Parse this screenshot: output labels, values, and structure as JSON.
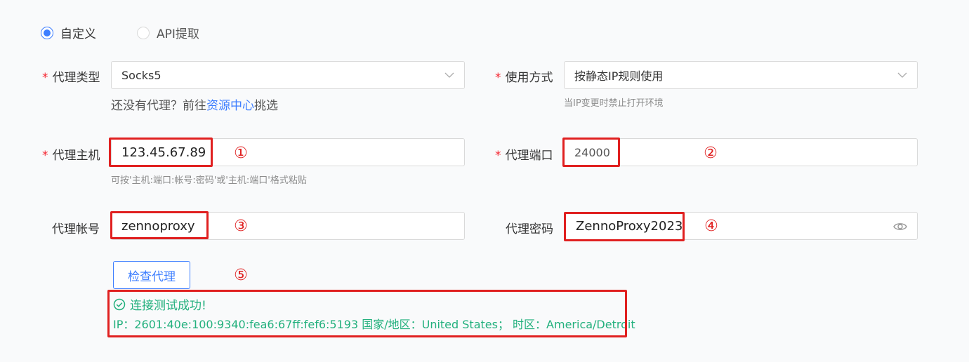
{
  "source_mode": {
    "options": [
      {
        "label": "自定义",
        "selected": true
      },
      {
        "label": "API提取",
        "selected": false
      }
    ]
  },
  "proxy_type": {
    "label": "代理类型",
    "value": "Socks5",
    "hint_prefix": "还没有代理？前往",
    "hint_link": "资源中心",
    "hint_suffix": "挑选"
  },
  "usage_mode": {
    "label": "使用方式",
    "value": "按静态IP规则使用",
    "hint": "当IP变更时禁止打开环境"
  },
  "proxy_host": {
    "label": "代理主机",
    "value": "123.45.67.89",
    "hint": "可按'主机:端口:帐号:密码'或'主机:端口'格式粘贴"
  },
  "proxy_port": {
    "label": "代理端口",
    "value": "24000"
  },
  "proxy_account": {
    "label": "代理帐号",
    "value": "zennoproxy"
  },
  "proxy_password": {
    "label": "代理密码",
    "value": "ZennoProxy2023"
  },
  "check_button": {
    "label": "检查代理"
  },
  "result": {
    "status": "连接测试成功!",
    "detail": "IP：2601:40e:100:9340:fea6:67ff:fef6:5193 国家/地区：United States； 时区：America/Detroit"
  },
  "markers": [
    "①",
    "②",
    "③",
    "④",
    "⑤"
  ],
  "colors": {
    "accent": "#3d7eff",
    "required": "#f5222d",
    "success": "#22b07d",
    "annotation": "#e02020"
  }
}
